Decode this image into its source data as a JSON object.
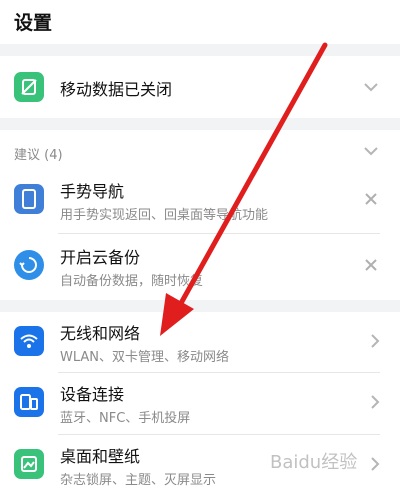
{
  "header": {
    "title": "设置"
  },
  "mobile_data": {
    "label": "移动数据已关闭",
    "icon": "mobile-data-off-icon"
  },
  "suggestions": {
    "title": "建议 (4)",
    "items": [
      {
        "label": "手势导航",
        "sub": "用手势实现返回、回桌面等导航功能",
        "icon": "gesture-phone-icon"
      },
      {
        "label": "开启云备份",
        "sub": "自动备份数据，随时恢复",
        "icon": "cloud-backup-icon"
      }
    ]
  },
  "settings": {
    "items": [
      {
        "label": "无线和网络",
        "sub": "WLAN、双卡管理、移动网络",
        "icon": "wifi-icon"
      },
      {
        "label": "设备连接",
        "sub": "蓝牙、NFC、手机投屏",
        "icon": "device-connection-icon"
      },
      {
        "label": "桌面和壁纸",
        "sub": "杂志锁屏、主题、灭屏显示",
        "icon": "wallpaper-icon"
      }
    ]
  },
  "watermark": {
    "text": "Baidu经验"
  },
  "colors": {
    "accent_blue": "#1a73e8",
    "green": "#39c27a",
    "arrow_red": "#e01e1e",
    "background": "#f1f3f5"
  }
}
